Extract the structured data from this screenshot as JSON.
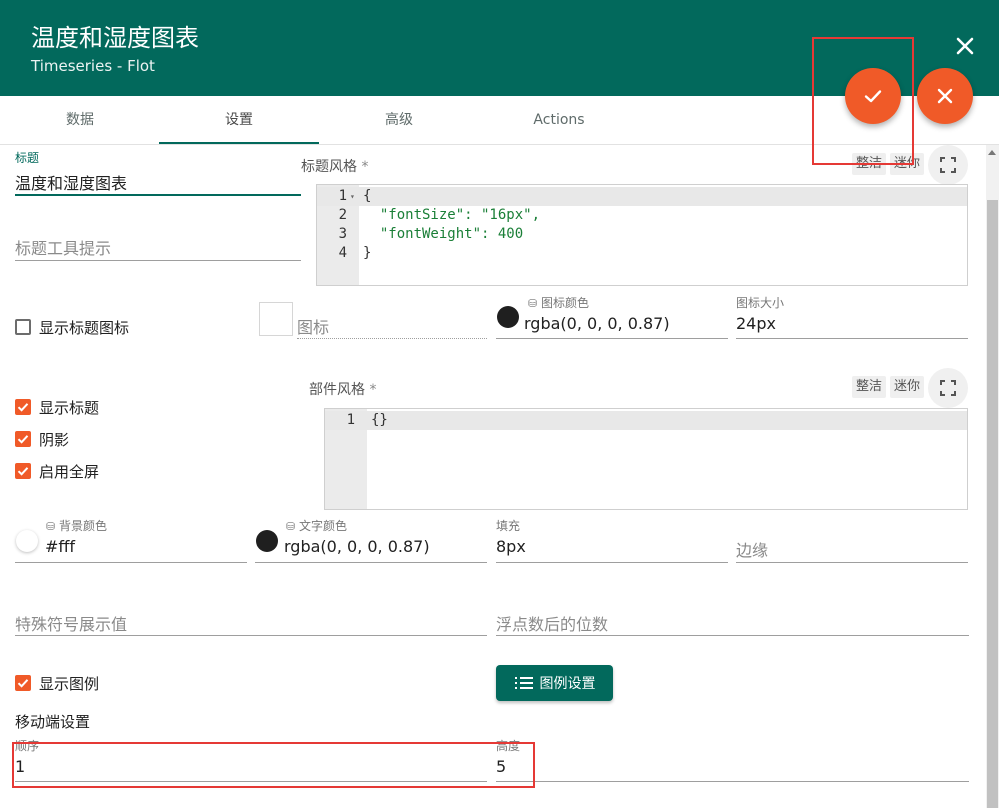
{
  "dialog": {
    "title": "温度和湿度图表",
    "subtitle": "Timeseries - Flot"
  },
  "tabs": [
    "数据",
    "设置",
    "高级",
    "Actions"
  ],
  "fields": {
    "title_label": "标题",
    "title_value": "温度和湿度图表",
    "tooltip_placeholder": "标题工具提示",
    "title_style_label": "标题风格",
    "widget_style_label": "部件风格",
    "icon_placeholder": "图标",
    "icon_color_label": "图标颜色",
    "icon_color_value": "rgba(0, 0, 0, 0.87)",
    "icon_size_label": "图标大小",
    "icon_size_value": "24px",
    "bg_color_label": "背景颜色",
    "bg_color_value": "#fff",
    "text_color_label": "文字颜色",
    "text_color_value": "rgba(0, 0, 0, 0.87)",
    "padding_label": "填充",
    "padding_value": "8px",
    "margin_placeholder": "边缘",
    "units_placeholder": "特殊符号展示值",
    "decimals_placeholder": "浮点数后的位数",
    "order_label": "顺序",
    "order_value": "1",
    "height_label": "高度",
    "height_value": "5"
  },
  "editor_buttons": {
    "tidy": "整洁",
    "mini": "迷你"
  },
  "title_style_code": {
    "line_numbers": [
      "1",
      "2",
      "3",
      "4"
    ],
    "lines": [
      "{",
      "  \"fontSize\": \"16px\",",
      "  \"fontWeight\": 400",
      "}"
    ]
  },
  "widget_style_code": {
    "line_numbers": [
      "1"
    ],
    "lines": [
      "{}"
    ]
  },
  "checkboxes": {
    "show_title_icon": {
      "label": "显示标题图标",
      "checked": false
    },
    "show_title": {
      "label": "显示标题",
      "checked": true
    },
    "shadow": {
      "label": "阴影",
      "checked": true
    },
    "fullscreen": {
      "label": "启用全屏",
      "checked": true
    },
    "show_legend": {
      "label": "显示图例",
      "checked": true
    }
  },
  "legend_settings_button": "图例设置",
  "mobile_section_title": "移动端设置",
  "required_mark": "*",
  "colors": {
    "header": "#02695c",
    "accent": "#f05a28",
    "highlight_box": "#e53935"
  }
}
